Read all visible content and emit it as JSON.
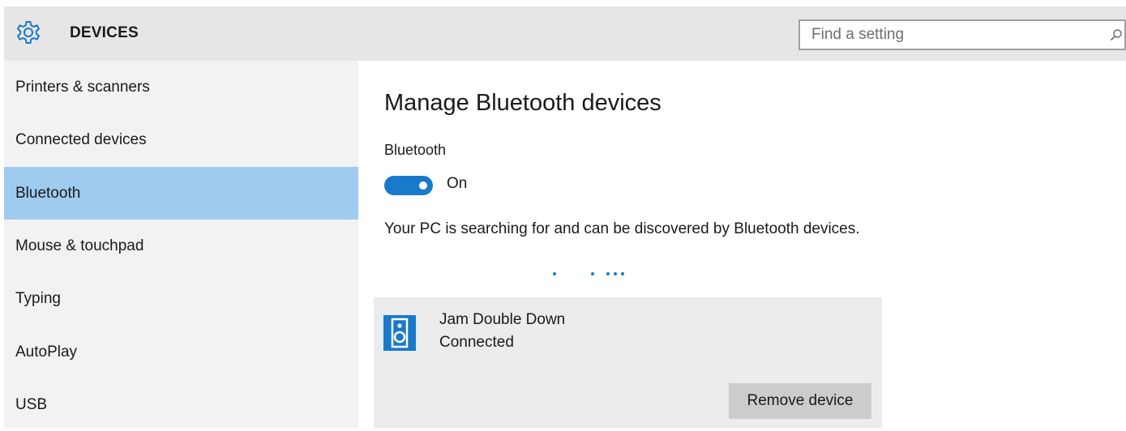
{
  "header": {
    "title": "DEVICES",
    "gear_icon": "gear-icon",
    "search": {
      "placeholder": "Find a setting",
      "value": "",
      "icon": "search-icon"
    }
  },
  "sidebar": {
    "items": [
      {
        "label": "Printers & scanners",
        "selected": false
      },
      {
        "label": "Connected devices",
        "selected": false
      },
      {
        "label": "Bluetooth",
        "selected": true
      },
      {
        "label": "Mouse & touchpad",
        "selected": false
      },
      {
        "label": "Typing",
        "selected": false
      },
      {
        "label": "AutoPlay",
        "selected": false
      },
      {
        "label": "USB",
        "selected": false
      }
    ]
  },
  "main": {
    "title": "Manage Bluetooth devices",
    "bluetooth_label": "Bluetooth",
    "toggle": {
      "state": "On",
      "on": true
    },
    "status_text": "Your PC is searching for and can be discovered by Bluetooth devices.",
    "device": {
      "name": "Jam Double Down",
      "status": "Connected",
      "icon": "speaker-icon",
      "remove_label": "Remove device"
    }
  },
  "colors": {
    "accent": "#1979ca",
    "selected_nav": "#9fcbee",
    "header_bg": "#e6e6e6",
    "sidebar_bg": "#f2f2f2",
    "card_bg": "#ececec",
    "button_bg": "#cccccc"
  }
}
